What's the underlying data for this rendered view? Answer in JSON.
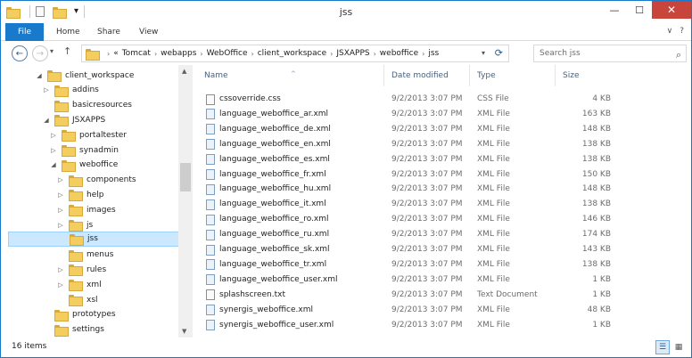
{
  "window": {
    "title": "jss",
    "minimize_glyph": "—",
    "maximize_glyph": "☐",
    "close_glyph": "✕"
  },
  "ribbon": {
    "tabs": [
      {
        "label": "File"
      },
      {
        "label": "Home"
      },
      {
        "label": "Share"
      },
      {
        "label": "View"
      }
    ],
    "collapse_glyph": "∨",
    "help_glyph": "?"
  },
  "navigation": {
    "back_glyph": "←",
    "forward_glyph": "→",
    "recent_glyph": "▾",
    "up_glyph": "↑",
    "overflow_glyph": "«",
    "breadcrumbs": [
      "Tomcat",
      "webapps",
      "WebOffice",
      "client_workspace",
      "JSXAPPS",
      "weboffice",
      "jss"
    ],
    "crumb_sep": "›",
    "search_placeholder": "Search jss"
  },
  "tree": [
    {
      "label": "client_workspace",
      "indent": 0,
      "arrow": "◢",
      "selected": false
    },
    {
      "label": "addins",
      "indent": 1,
      "arrow": "▷",
      "selected": false
    },
    {
      "label": "basicresources",
      "indent": 1,
      "arrow": "",
      "selected": false
    },
    {
      "label": "JSXAPPS",
      "indent": 1,
      "arrow": "◢",
      "selected": false
    },
    {
      "label": "portaltester",
      "indent": 2,
      "arrow": "▷",
      "selected": false
    },
    {
      "label": "synadmin",
      "indent": 2,
      "arrow": "▷",
      "selected": false
    },
    {
      "label": "weboffice",
      "indent": 2,
      "arrow": "◢",
      "selected": false
    },
    {
      "label": "components",
      "indent": 3,
      "arrow": "▷",
      "selected": false
    },
    {
      "label": "help",
      "indent": 3,
      "arrow": "▷",
      "selected": false
    },
    {
      "label": "images",
      "indent": 3,
      "arrow": "▷",
      "selected": false
    },
    {
      "label": "js",
      "indent": 3,
      "arrow": "▷",
      "selected": false
    },
    {
      "label": "jss",
      "indent": 3,
      "arrow": "",
      "selected": true
    },
    {
      "label": "menus",
      "indent": 3,
      "arrow": "",
      "selected": false
    },
    {
      "label": "rules",
      "indent": 3,
      "arrow": "▷",
      "selected": false
    },
    {
      "label": "xml",
      "indent": 3,
      "arrow": "▷",
      "selected": false
    },
    {
      "label": "xsl",
      "indent": 3,
      "arrow": "",
      "selected": false
    },
    {
      "label": "prototypes",
      "indent": 1,
      "arrow": "",
      "selected": false
    },
    {
      "label": "settings",
      "indent": 1,
      "arrow": "",
      "selected": false
    }
  ],
  "columns": {
    "name": "Name",
    "date": "Date modified",
    "type": "Type",
    "size": "Size",
    "sort_glyph": "^"
  },
  "files": [
    {
      "name": "cssoverride.css",
      "date": "9/2/2013 3:07 PM",
      "type": "CSS File",
      "size": "4 KB",
      "kind": "txt"
    },
    {
      "name": "language_weboffice_ar.xml",
      "date": "9/2/2013 3:07 PM",
      "type": "XML File",
      "size": "163 KB",
      "kind": "xml"
    },
    {
      "name": "language_weboffice_de.xml",
      "date": "9/2/2013 3:07 PM",
      "type": "XML File",
      "size": "148 KB",
      "kind": "xml"
    },
    {
      "name": "language_weboffice_en.xml",
      "date": "9/2/2013 3:07 PM",
      "type": "XML File",
      "size": "138 KB",
      "kind": "xml"
    },
    {
      "name": "language_weboffice_es.xml",
      "date": "9/2/2013 3:07 PM",
      "type": "XML File",
      "size": "138 KB",
      "kind": "xml"
    },
    {
      "name": "language_weboffice_fr.xml",
      "date": "9/2/2013 3:07 PM",
      "type": "XML File",
      "size": "150 KB",
      "kind": "xml"
    },
    {
      "name": "language_weboffice_hu.xml",
      "date": "9/2/2013 3:07 PM",
      "type": "XML File",
      "size": "148 KB",
      "kind": "xml"
    },
    {
      "name": "language_weboffice_it.xml",
      "date": "9/2/2013 3:07 PM",
      "type": "XML File",
      "size": "138 KB",
      "kind": "xml"
    },
    {
      "name": "language_weboffice_ro.xml",
      "date": "9/2/2013 3:07 PM",
      "type": "XML File",
      "size": "146 KB",
      "kind": "xml"
    },
    {
      "name": "language_weboffice_ru.xml",
      "date": "9/2/2013 3:07 PM",
      "type": "XML File",
      "size": "174 KB",
      "kind": "xml"
    },
    {
      "name": "language_weboffice_sk.xml",
      "date": "9/2/2013 3:07 PM",
      "type": "XML File",
      "size": "143 KB",
      "kind": "xml"
    },
    {
      "name": "language_weboffice_tr.xml",
      "date": "9/2/2013 3:07 PM",
      "type": "XML File",
      "size": "138 KB",
      "kind": "xml"
    },
    {
      "name": "language_weboffice_user.xml",
      "date": "9/2/2013 3:07 PM",
      "type": "XML File",
      "size": "1 KB",
      "kind": "xml"
    },
    {
      "name": "splashscreen.txt",
      "date": "9/2/2013 3:07 PM",
      "type": "Text Document",
      "size": "1 KB",
      "kind": "txt"
    },
    {
      "name": "synergis_weboffice.xml",
      "date": "9/2/2013 3:07 PM",
      "type": "XML File",
      "size": "48 KB",
      "kind": "xml"
    },
    {
      "name": "synergis_weboffice_user.xml",
      "date": "9/2/2013 3:07 PM",
      "type": "XML File",
      "size": "1 KB",
      "kind": "xml"
    }
  ],
  "status": {
    "item_count": "16 items",
    "details_view_glyph": "☰",
    "icons_view_glyph": "▦"
  },
  "colors": {
    "accent": "#1979ca",
    "selection": "#cce8ff",
    "close": "#c7453b",
    "folder": "#f3cd5d"
  }
}
